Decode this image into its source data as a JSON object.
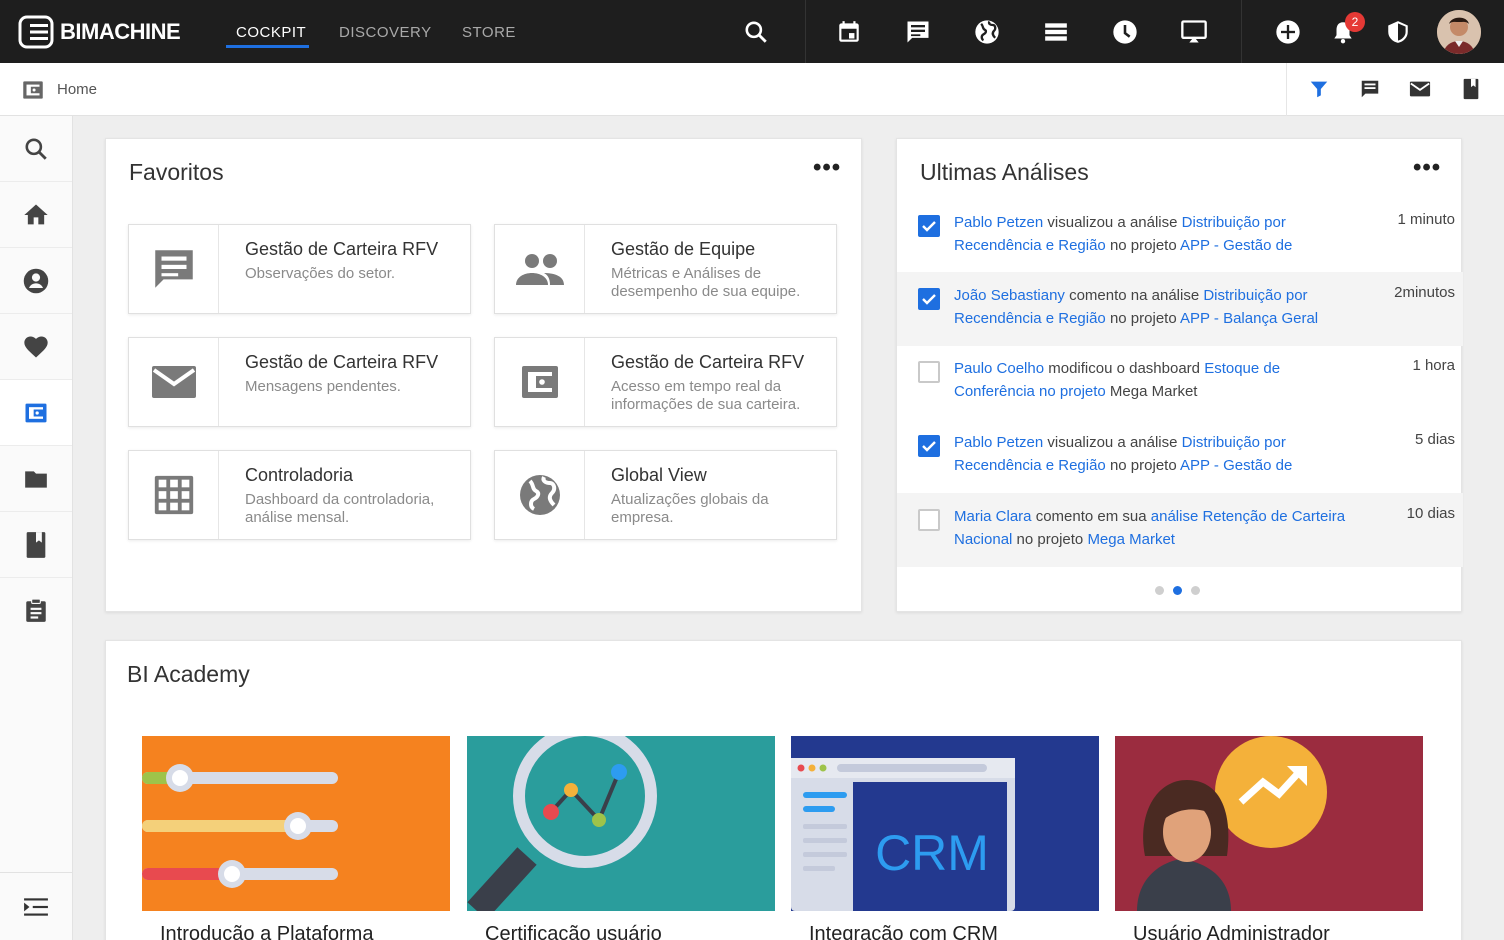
{
  "app": {
    "brand": "BIMACHINE",
    "accent": "#1e6fe0"
  },
  "topbar": {
    "tabs": [
      {
        "label": "COCKPIT",
        "active": true
      },
      {
        "label": "DISCOVERY",
        "active": false
      },
      {
        "label": "STORE",
        "active": false
      }
    ],
    "icons": [
      "search-icon",
      "calendar-icon",
      "message-icon",
      "globe-icon",
      "list-icon",
      "clock-icon",
      "cast-icon",
      "add-icon",
      "bell-icon",
      "shield-icon"
    ],
    "notification_count": "2"
  },
  "subbar": {
    "title": "Home",
    "icons": [
      "filter-icon",
      "comment-icon",
      "mail-icon",
      "book-icon"
    ]
  },
  "sidebar": {
    "items": [
      "search-icon",
      "home-icon",
      "account-icon",
      "heart-icon",
      "wallet-icon",
      "folder-icon",
      "book-icon",
      "clipboard-icon"
    ],
    "active_index": 4
  },
  "favoritos": {
    "title": "Favoritos",
    "more": "•••",
    "tiles": [
      {
        "title": "Gestão de Carteira RFV",
        "desc": "Observações do setor.",
        "icon": "comment-icon"
      },
      {
        "title": "Gestão de Equipe",
        "desc": "Métricas e Análises de desempenho de sua equipe.",
        "icon": "people-icon"
      },
      {
        "title": "Gestão de Carteira RFV",
        "desc": "Mensagens pendentes.",
        "icon": "mail-icon"
      },
      {
        "title": "Gestão de Carteira RFV",
        "desc": "Acesso em tempo real da informações de sua carteira.",
        "icon": "wallet-icon"
      },
      {
        "title": "Controladoria",
        "desc": "Dashboard da controladoria, análise mensal.",
        "icon": "grid-icon"
      },
      {
        "title": "Global View",
        "desc": "Atualizações globais da empresa.",
        "icon": "globe-icon"
      }
    ]
  },
  "analises": {
    "title": "Ultimas Análises",
    "more": "•••",
    "rows": [
      {
        "checked": true,
        "shaded": false,
        "time": "1 minuto",
        "parts": [
          {
            "t": "Pablo Petzen",
            "link": true
          },
          {
            "t": " visualizou a análise ",
            "link": false
          },
          {
            "t": "Distribuição por Recendência e Região",
            "link": true
          },
          {
            "t": " no projeto ",
            "link": false
          },
          {
            "t": "APP - Gestão de",
            "link": true
          }
        ]
      },
      {
        "checked": true,
        "shaded": true,
        "time": "2minutos",
        "parts": [
          {
            "t": "João Sebastiany",
            "link": true
          },
          {
            "t": " comento na análise ",
            "link": false
          },
          {
            "t": "Distribuição por Recendência e Região",
            "link": true
          },
          {
            "t": " no projeto ",
            "link": false
          },
          {
            "t": "APP - Balança Geral",
            "link": true
          }
        ]
      },
      {
        "checked": false,
        "shaded": false,
        "time": "1 hora",
        "parts": [
          {
            "t": "Paulo Coelho",
            "link": true
          },
          {
            "t": " modificou o dashboard ",
            "link": false
          },
          {
            "t": "Estoque de Conferência no projeto",
            "link": true
          },
          {
            "t": " Mega Market",
            "link": false
          }
        ]
      },
      {
        "checked": true,
        "shaded": false,
        "time": "5 dias",
        "parts": [
          {
            "t": "Pablo Petzen",
            "link": true
          },
          {
            "t": " visualizou a análise ",
            "link": false
          },
          {
            "t": "Distribuição por Recendência e Região",
            "link": true
          },
          {
            "t": " no projeto ",
            "link": false
          },
          {
            "t": "APP - Gestão de",
            "link": true
          }
        ]
      },
      {
        "checked": false,
        "shaded": true,
        "time": "10 dias",
        "parts": [
          {
            "t": "Maria Clara",
            "link": true
          },
          {
            "t": " comento em sua ",
            "link": false
          },
          {
            "t": "análise  Retenção de Carteira Nacional",
            "link": true
          },
          {
            "t": " no projeto ",
            "link": false
          },
          {
            "t": "Mega Market",
            "link": true
          }
        ]
      }
    ],
    "pagination": {
      "pages": 3,
      "current": 2
    }
  },
  "academy": {
    "title": "BI Academy",
    "courses": [
      {
        "title": "Introdução a Plataforma",
        "color": "#f5821f"
      },
      {
        "title": "Certificação usuário",
        "color": "#2a9d9c"
      },
      {
        "title": "Integração com CRM",
        "color": "#23398f",
        "art_text": "CRM"
      },
      {
        "title": "Usuário Administrador",
        "color": "#9b2c3f"
      }
    ]
  }
}
